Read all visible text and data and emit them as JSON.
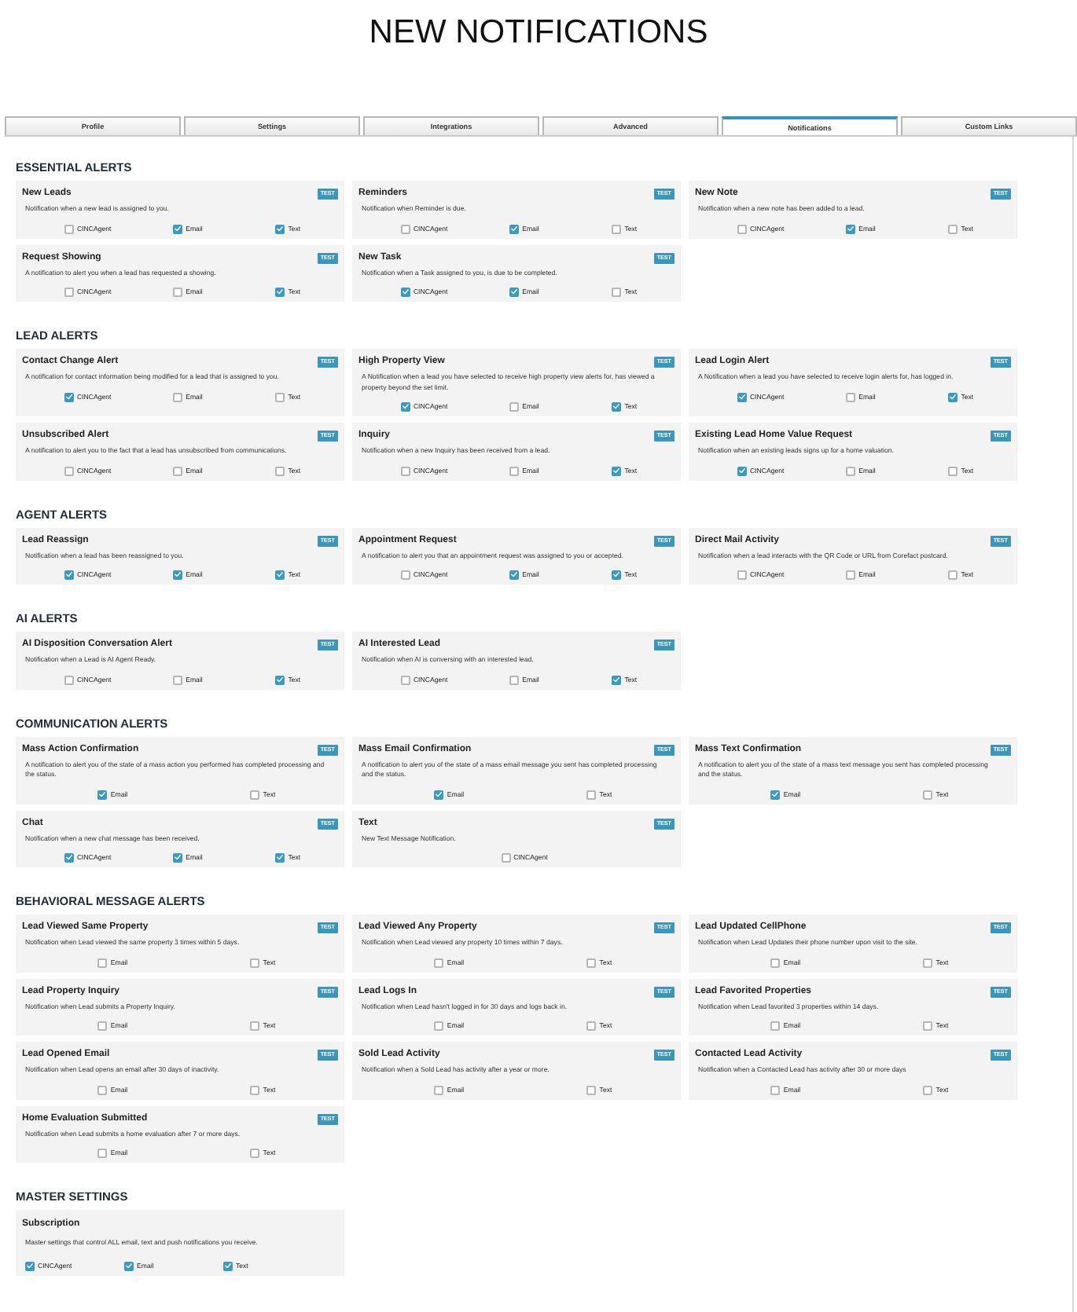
{
  "page": {
    "title": "NEW NOTIFICATIONS"
  },
  "tabs": [
    {
      "label": "Profile",
      "selected": false
    },
    {
      "label": "Settings",
      "selected": false
    },
    {
      "label": "Integrations",
      "selected": false
    },
    {
      "label": "Advanced",
      "selected": false
    },
    {
      "label": "Notifications",
      "selected": true
    },
    {
      "label": "Custom Links",
      "selected": false
    }
  ],
  "sections": [
    {
      "heading": "ESSENTIAL ALERTS",
      "kind": "alerts",
      "alerts": [
        {
          "title": "New Leads",
          "test_label": "TEST",
          "description": "Notification when a new lead is assigned to you.",
          "options": [
            {
              "label": "CINCAgent",
              "checked": false
            },
            {
              "label": "Email",
              "checked": true
            },
            {
              "label": "Text",
              "checked": true
            }
          ]
        },
        {
          "title": "Reminders",
          "test_label": "TEST",
          "description": "Notification when Reminder is due.",
          "options": [
            {
              "label": "CINCAgent",
              "checked": false
            },
            {
              "label": "Email",
              "checked": true
            },
            {
              "label": "Text",
              "checked": false
            }
          ]
        },
        {
          "title": "New Note",
          "test_label": "TEST",
          "description": "Notification when a new note has been added to a lead.",
          "options": [
            {
              "label": "CINCAgent",
              "checked": false
            },
            {
              "label": "Email",
              "checked": true
            },
            {
              "label": "Text",
              "checked": false
            }
          ]
        },
        {
          "title": "Request Showing",
          "test_label": "TEST",
          "description": "A notification to alert you when a lead has requested a showing.",
          "options": [
            {
              "label": "CINCAgent",
              "checked": false
            },
            {
              "label": "Email",
              "checked": false
            },
            {
              "label": "Text",
              "checked": true
            }
          ]
        },
        {
          "title": "New Task",
          "test_label": "TEST",
          "description": "Notification when a Task assigned to you, is due to be completed.",
          "options": [
            {
              "label": "CINCAgent",
              "checked": true
            },
            {
              "label": "Email",
              "checked": true
            },
            {
              "label": "Text",
              "checked": false
            }
          ]
        }
      ]
    },
    {
      "heading": "LEAD ALERTS",
      "kind": "alerts",
      "alerts": [
        {
          "title": "Contact Change Alert",
          "test_label": "TEST",
          "description": "A notification for contact information being modified for a lead that is assigned to you.",
          "options": [
            {
              "label": "CINCAgent",
              "checked": true
            },
            {
              "label": "Email",
              "checked": false
            },
            {
              "label": "Text",
              "checked": false
            }
          ]
        },
        {
          "title": "High Property View",
          "test_label": "TEST",
          "description": "A Notification when a lead you have selected to receive high property view alerts for, has viewed a property beyond the set limit.",
          "options": [
            {
              "label": "CINCAgent",
              "checked": true
            },
            {
              "label": "Email",
              "checked": false
            },
            {
              "label": "Text",
              "checked": true
            }
          ]
        },
        {
          "title": "Lead Login Alert",
          "test_label": "TEST",
          "description": "A Notification when a lead you have selected to receive login alerts for, has logged in.",
          "options": [
            {
              "label": "CINCAgent",
              "checked": true
            },
            {
              "label": "Email",
              "checked": false
            },
            {
              "label": "Text",
              "checked": true
            }
          ]
        },
        {
          "title": "Unsubscribed Alert",
          "test_label": "TEST",
          "description": "A notification to alert you to the fact that a lead has unsubscribed from communications.",
          "options": [
            {
              "label": "CINCAgent",
              "checked": false
            },
            {
              "label": "Email",
              "checked": false
            },
            {
              "label": "Text",
              "checked": false
            }
          ]
        },
        {
          "title": "Inquiry",
          "test_label": "TEST",
          "description": "Notification when a new Inquiry has been received from a lead.",
          "options": [
            {
              "label": "CINCAgent",
              "checked": false
            },
            {
              "label": "Email",
              "checked": false
            },
            {
              "label": "Text",
              "checked": true
            }
          ]
        },
        {
          "title": "Existing Lead Home Value Request",
          "test_label": "TEST",
          "description": "Notification when an existing leads signs up for a home valuation.",
          "options": [
            {
              "label": "CINCAgent",
              "checked": true
            },
            {
              "label": "Email",
              "checked": false
            },
            {
              "label": "Text",
              "checked": false
            }
          ]
        }
      ]
    },
    {
      "heading": "AGENT ALERTS",
      "kind": "alerts",
      "alerts": [
        {
          "title": "Lead Reassign",
          "test_label": "TEST",
          "description": "Notification when a lead has been reassigned to you.",
          "options": [
            {
              "label": "CINCAgent",
              "checked": true
            },
            {
              "label": "Email",
              "checked": true
            },
            {
              "label": "Text",
              "checked": true
            }
          ]
        },
        {
          "title": "Appointment Request",
          "test_label": "TEST",
          "description": "A notification to alert you that an appointment request was assigned to you or accepted.",
          "options": [
            {
              "label": "CINCAgent",
              "checked": false
            },
            {
              "label": "Email",
              "checked": true
            },
            {
              "label": "Text",
              "checked": true
            }
          ]
        },
        {
          "title": "Direct Mail Activity",
          "test_label": "TEST",
          "description": "Notification when a lead interacts with the QR Code or URL from Corefact postcard.",
          "options": [
            {
              "label": "CINCAgent",
              "checked": false
            },
            {
              "label": "Email",
              "checked": false
            },
            {
              "label": "Text",
              "checked": false
            }
          ]
        }
      ]
    },
    {
      "heading": "AI ALERTS",
      "kind": "alerts",
      "alerts": [
        {
          "title": "AI Disposition Conversation Alert",
          "test_label": "TEST",
          "description": "Notification when a Lead is AI Agent Ready.",
          "options": [
            {
              "label": "CINCAgent",
              "checked": false
            },
            {
              "label": "Email",
              "checked": false
            },
            {
              "label": "Text",
              "checked": true
            }
          ]
        },
        {
          "title": "AI Interested Lead",
          "test_label": "TEST",
          "description": "Notification when AI is conversing with an interested lead.",
          "options": [
            {
              "label": "CINCAgent",
              "checked": false
            },
            {
              "label": "Email",
              "checked": false
            },
            {
              "label": "Text",
              "checked": true
            }
          ]
        }
      ]
    },
    {
      "heading": "COMMUNICATION ALERTS",
      "kind": "alerts",
      "alerts": [
        {
          "title": "Mass Action Confirmation",
          "test_label": "TEST",
          "description": "A notification to alert you of the state of a mass action you performed has completed processing and the status.",
          "options": [
            {
              "label": "Email",
              "checked": true
            },
            {
              "label": "Text",
              "checked": false
            }
          ]
        },
        {
          "title": "Mass Email Confirmation",
          "test_label": "TEST",
          "description": "A notification to alert you of the state of a mass email message you sent has completed processing and the status.",
          "options": [
            {
              "label": "Email",
              "checked": true
            },
            {
              "label": "Text",
              "checked": false
            }
          ]
        },
        {
          "title": "Mass Text Confirmation",
          "test_label": "TEST",
          "description": "A notification to alert you of the state of a mass text message you sent has completed processing and the status.",
          "options": [
            {
              "label": "Email",
              "checked": true
            },
            {
              "label": "Text",
              "checked": false
            }
          ]
        },
        {
          "title": "Chat",
          "test_label": "TEST",
          "description": "Notification when a new chat message has been received.",
          "options": [
            {
              "label": "CINCAgent",
              "checked": true
            },
            {
              "label": "Email",
              "checked": true
            },
            {
              "label": "Text",
              "checked": true
            }
          ]
        },
        {
          "title": "Text",
          "test_label": "TEST",
          "description": "New Text Message Notification.",
          "options": [
            {
              "label": "CINCAgent",
              "checked": false
            }
          ]
        }
      ]
    },
    {
      "heading": "BEHAVIORAL MESSAGE ALERTS",
      "kind": "alerts",
      "alerts": [
        {
          "title": "Lead Viewed Same Property",
          "test_label": "TEST",
          "description": "Notification when Lead viewed the same property 3 times within 5 days.",
          "options": [
            {
              "label": "Email",
              "checked": false
            },
            {
              "label": "Text",
              "checked": false
            }
          ]
        },
        {
          "title": "Lead Viewed Any Property",
          "test_label": "TEST",
          "description": "Notification when Lead viewed any property 10 times within 7 days.",
          "options": [
            {
              "label": "Email",
              "checked": false
            },
            {
              "label": "Text",
              "checked": false
            }
          ]
        },
        {
          "title": "Lead Updated CellPhone",
          "test_label": "TEST",
          "description": "Notification when Lead Updates their phone number upon visit to the site.",
          "options": [
            {
              "label": "Email",
              "checked": false
            },
            {
              "label": "Text",
              "checked": false
            }
          ]
        },
        {
          "title": "Lead Property Inquiry",
          "test_label": "TEST",
          "description": "Notification when Lead submits a Property Inquiry.",
          "options": [
            {
              "label": "Email",
              "checked": false
            },
            {
              "label": "Text",
              "checked": false
            }
          ]
        },
        {
          "title": "Lead Logs In",
          "test_label": "TEST",
          "description": "Notification when Lead hasn't logged in for 30 days and logs back in.",
          "options": [
            {
              "label": "Email",
              "checked": false
            },
            {
              "label": "Text",
              "checked": false
            }
          ]
        },
        {
          "title": "Lead Favorited Properties",
          "test_label": "TEST",
          "description": "Notification when Lead favorited 3 properties within 14 days.",
          "options": [
            {
              "label": "Email",
              "checked": false
            },
            {
              "label": "Text",
              "checked": false
            }
          ]
        },
        {
          "title": "Lead Opened Email",
          "test_label": "TEST",
          "description": "Notification when Lead opens an email after 30 days of inactivity.",
          "options": [
            {
              "label": "Email",
              "checked": false
            },
            {
              "label": "Text",
              "checked": false
            }
          ]
        },
        {
          "title": "Sold Lead Activity",
          "test_label": "TEST",
          "description": "Notification when a Sold Lead has activity after a year or more.",
          "options": [
            {
              "label": "Email",
              "checked": false
            },
            {
              "label": "Text",
              "checked": false
            }
          ]
        },
        {
          "title": "Contacted Lead Activity",
          "test_label": "TEST",
          "description": "Notification when a Contacted Lead has activity after 30 or more days",
          "options": [
            {
              "label": "Email",
              "checked": false
            },
            {
              "label": "Text",
              "checked": false
            }
          ]
        },
        {
          "title": "Home Evaluation Submitted",
          "test_label": "TEST",
          "description": "Notification when Lead submits a home evaluation after 7 or more days.",
          "options": [
            {
              "label": "Email",
              "checked": false
            },
            {
              "label": "Text",
              "checked": false
            }
          ]
        }
      ]
    },
    {
      "heading": "MASTER SETTINGS",
      "kind": "master",
      "alerts": [
        {
          "title": "Subscription",
          "description": "Master settings that control ALL email, text and push notifications you receive.",
          "options": [
            {
              "label": "CINCAgent",
              "checked": true
            },
            {
              "label": "Email",
              "checked": true
            },
            {
              "label": "Text",
              "checked": true
            }
          ]
        }
      ]
    }
  ]
}
